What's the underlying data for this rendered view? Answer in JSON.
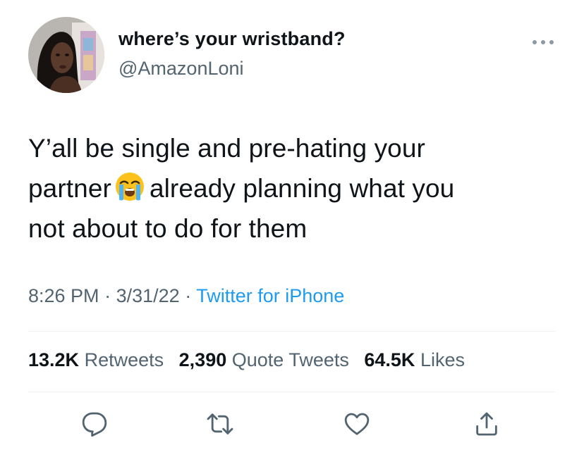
{
  "author": {
    "display_name": "where’s your wristband?",
    "handle": "@AmazonLoni"
  },
  "tweet": {
    "text_line1": "Y’all be single and pre-hating your",
    "text_line2_before": "partner",
    "emoji": "loudly-crying-face",
    "text_line2_after": "already planning what you",
    "text_line3": "not about to do for them"
  },
  "meta": {
    "time": "8:26 PM",
    "separator": "·",
    "date": "3/31/22",
    "source": "Twitter for iPhone"
  },
  "stats": {
    "retweets_count": "13.2K",
    "retweets_label": "Retweets",
    "quotes_count": "2,390",
    "quotes_label": "Quote Tweets",
    "likes_count": "64.5K",
    "likes_label": "Likes"
  },
  "actions": [
    "reply-icon",
    "retweet-icon",
    "like-icon",
    "share-icon"
  ],
  "colors": {
    "text": "#0f1419",
    "secondary": "#536471",
    "link": "#1d9bf0",
    "divider": "#eff3f4"
  }
}
